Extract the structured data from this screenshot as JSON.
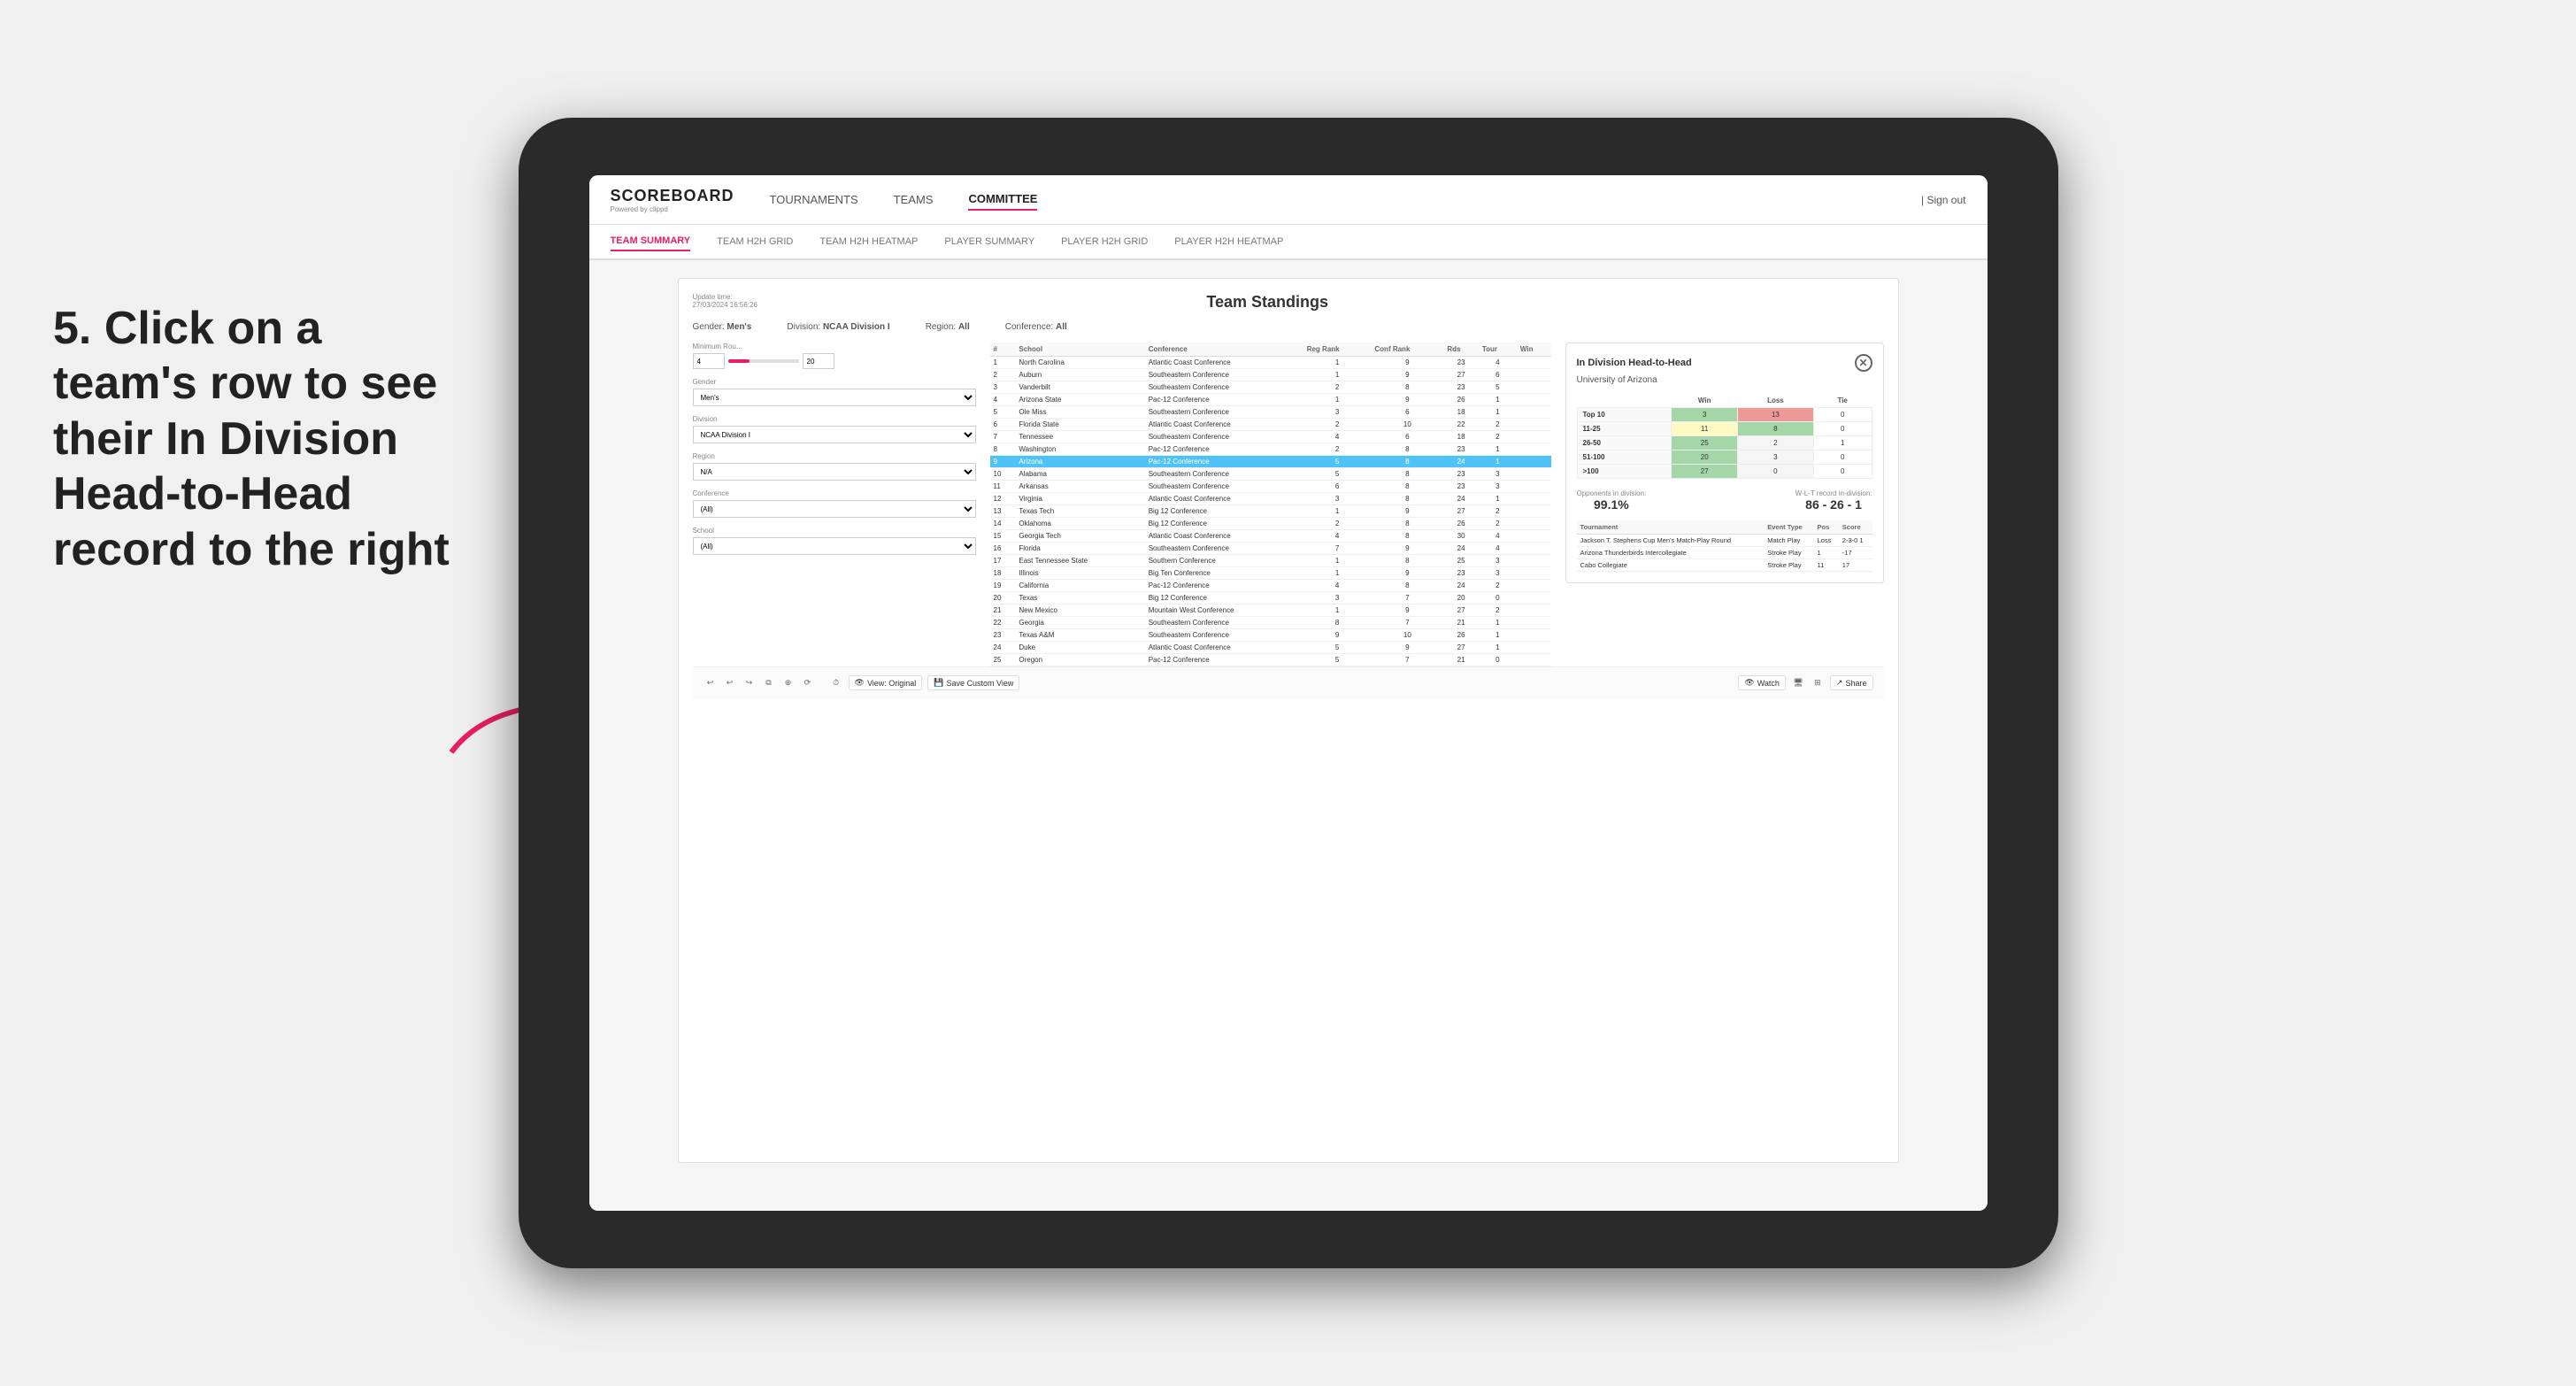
{
  "logo": {
    "name": "SCOREBOARD",
    "sub": "Powered by clippd"
  },
  "nav": {
    "items": [
      "TOURNAMENTS",
      "TEAMS",
      "COMMITTEE"
    ],
    "active": "COMMITTEE",
    "sign_out": "Sign out"
  },
  "sub_nav": {
    "items": [
      "TEAM SUMMARY",
      "TEAM H2H GRID",
      "TEAM H2H HEATMAP",
      "PLAYER SUMMARY",
      "PLAYER H2H GRID",
      "PLAYER H2H HEATMAP"
    ],
    "active": "TEAM SUMMARY"
  },
  "panel": {
    "update_time_label": "Update time:",
    "update_time_value": "27/03/2024 16:56:26",
    "title": "Team Standings",
    "filters": {
      "gender_label": "Gender:",
      "gender_value": "Men's",
      "division_label": "Division:",
      "division_value": "NCAA Division I",
      "region_label": "Region:",
      "region_value": "All",
      "conference_label": "Conference:",
      "conference_value": "All"
    }
  },
  "left_filters": {
    "min_rounds_label": "Minimum Rou...",
    "min_rounds_value": "4",
    "min_rounds_max": "20",
    "gender_label": "Gender",
    "gender_value": "Men's",
    "division_label": "Division",
    "division_value": "NCAA Division I",
    "region_label": "Region",
    "region_value": "N/A",
    "conference_label": "Conference",
    "conference_value": "(All)",
    "school_label": "School",
    "school_value": "(All)"
  },
  "table": {
    "headers": [
      "#",
      "School",
      "Conference",
      "Reg Rank",
      "Conf Rank",
      "Rds",
      "Tour",
      "Win"
    ],
    "rows": [
      {
        "num": 1,
        "school": "North Carolina",
        "conference": "Atlantic Coast Conference",
        "reg_rank": 1,
        "conf_rank": 9,
        "rds": 23,
        "tour": 4,
        "win": null,
        "highlighted": false
      },
      {
        "num": 2,
        "school": "Auburn",
        "conference": "Southeastern Conference",
        "reg_rank": 1,
        "conf_rank": 9,
        "rds": 27,
        "tour": 6,
        "win": null,
        "highlighted": false
      },
      {
        "num": 3,
        "school": "Vanderbilt",
        "conference": "Southeastern Conference",
        "reg_rank": 2,
        "conf_rank": 8,
        "rds": 23,
        "tour": 5,
        "win": null,
        "highlighted": false
      },
      {
        "num": 4,
        "school": "Arizona State",
        "conference": "Pac-12 Conference",
        "reg_rank": 1,
        "conf_rank": 9,
        "rds": 26,
        "tour": 1,
        "win": null,
        "highlighted": false
      },
      {
        "num": 5,
        "school": "Ole Miss",
        "conference": "Southeastern Conference",
        "reg_rank": 3,
        "conf_rank": 6,
        "rds": 18,
        "tour": 1,
        "win": null,
        "highlighted": false
      },
      {
        "num": 6,
        "school": "Florida State",
        "conference": "Atlantic Coast Conference",
        "reg_rank": 2,
        "conf_rank": 10,
        "rds": 22,
        "tour": 2,
        "win": null,
        "highlighted": false
      },
      {
        "num": 7,
        "school": "Tennessee",
        "conference": "Southeastern Conference",
        "reg_rank": 4,
        "conf_rank": 6,
        "rds": 18,
        "tour": 2,
        "win": null,
        "highlighted": false
      },
      {
        "num": 8,
        "school": "Washington",
        "conference": "Pac-12 Conference",
        "reg_rank": 2,
        "conf_rank": 8,
        "rds": 23,
        "tour": 1,
        "win": null,
        "highlighted": false
      },
      {
        "num": 9,
        "school": "Arizona",
        "conference": "Pac-12 Conference",
        "reg_rank": 5,
        "conf_rank": 8,
        "rds": 24,
        "tour": 1,
        "win": null,
        "highlighted": true
      },
      {
        "num": 10,
        "school": "Alabama",
        "conference": "Southeastern Conference",
        "reg_rank": 5,
        "conf_rank": 8,
        "rds": 23,
        "tour": 3,
        "win": null,
        "highlighted": false
      },
      {
        "num": 11,
        "school": "Arkansas",
        "conference": "Southeastern Conference",
        "reg_rank": 6,
        "conf_rank": 8,
        "rds": 23,
        "tour": 3,
        "win": null,
        "highlighted": false
      },
      {
        "num": 12,
        "school": "Virginia",
        "conference": "Atlantic Coast Conference",
        "reg_rank": 3,
        "conf_rank": 8,
        "rds": 24,
        "tour": 1,
        "win": null,
        "highlighted": false
      },
      {
        "num": 13,
        "school": "Texas Tech",
        "conference": "Big 12 Conference",
        "reg_rank": 1,
        "conf_rank": 9,
        "rds": 27,
        "tour": 2,
        "win": null,
        "highlighted": false
      },
      {
        "num": 14,
        "school": "Oklahoma",
        "conference": "Big 12 Conference",
        "reg_rank": 2,
        "conf_rank": 8,
        "rds": 26,
        "tour": 2,
        "win": null,
        "highlighted": false
      },
      {
        "num": 15,
        "school": "Georgia Tech",
        "conference": "Atlantic Coast Conference",
        "reg_rank": 4,
        "conf_rank": 8,
        "rds": 30,
        "tour": 4,
        "win": null,
        "highlighted": false
      },
      {
        "num": 16,
        "school": "Florida",
        "conference": "Southeastern Conference",
        "reg_rank": 7,
        "conf_rank": 9,
        "rds": 24,
        "tour": 4,
        "win": null,
        "highlighted": false
      },
      {
        "num": 17,
        "school": "East Tennessee State",
        "conference": "Southern Conference",
        "reg_rank": 1,
        "conf_rank": 8,
        "rds": 25,
        "tour": 3,
        "win": null,
        "highlighted": false
      },
      {
        "num": 18,
        "school": "Illinois",
        "conference": "Big Ten Conference",
        "reg_rank": 1,
        "conf_rank": 9,
        "rds": 23,
        "tour": 3,
        "win": null,
        "highlighted": false
      },
      {
        "num": 19,
        "school": "California",
        "conference": "Pac-12 Conference",
        "reg_rank": 4,
        "conf_rank": 8,
        "rds": 24,
        "tour": 2,
        "win": null,
        "highlighted": false
      },
      {
        "num": 20,
        "school": "Texas",
        "conference": "Big 12 Conference",
        "reg_rank": 3,
        "conf_rank": 7,
        "rds": 20,
        "tour": 0,
        "win": null,
        "highlighted": false
      },
      {
        "num": 21,
        "school": "New Mexico",
        "conference": "Mountain West Conference",
        "reg_rank": 1,
        "conf_rank": 9,
        "rds": 27,
        "tour": 2,
        "win": null,
        "highlighted": false
      },
      {
        "num": 22,
        "school": "Georgia",
        "conference": "Southeastern Conference",
        "reg_rank": 8,
        "conf_rank": 7,
        "rds": 21,
        "tour": 1,
        "win": null,
        "highlighted": false
      },
      {
        "num": 23,
        "school": "Texas A&M",
        "conference": "Southeastern Conference",
        "reg_rank": 9,
        "conf_rank": 10,
        "rds": 26,
        "tour": 1,
        "win": null,
        "highlighted": false
      },
      {
        "num": 24,
        "school": "Duke",
        "conference": "Atlantic Coast Conference",
        "reg_rank": 5,
        "conf_rank": 9,
        "rds": 27,
        "tour": 1,
        "win": null,
        "highlighted": false
      },
      {
        "num": 25,
        "school": "Oregon",
        "conference": "Pac-12 Conference",
        "reg_rank": 5,
        "conf_rank": 7,
        "rds": 21,
        "tour": 0,
        "win": null,
        "highlighted": false
      }
    ]
  },
  "h2h": {
    "title": "In Division Head-to-Head",
    "team": "University of Arizona",
    "col_headers": [
      "Win",
      "Loss",
      "Tie"
    ],
    "ranges": [
      {
        "label": "Top 10",
        "win": 3,
        "loss": 13,
        "tie": 0,
        "win_color": "green",
        "loss_color": "red"
      },
      {
        "label": "11-25",
        "win": 11,
        "loss": 8,
        "tie": 0,
        "win_color": "yellow",
        "loss_color": "green"
      },
      {
        "label": "26-50",
        "win": 25,
        "loss": 2,
        "tie": 1,
        "win_color": "green",
        "loss_color": "gray"
      },
      {
        "label": "51-100",
        "win": 20,
        "loss": 3,
        "tie": 0,
        "win_color": "green",
        "loss_color": "gray"
      },
      {
        "label": ">100",
        "win": 27,
        "loss": 0,
        "tie": 0,
        "win_color": "green",
        "loss_color": "gray"
      }
    ],
    "opponents_label": "Opponents in division:",
    "opponents_value": "99.1%",
    "record_label": "W-L-T record in-division:",
    "record_value": "86 - 26 - 1",
    "tournaments": [
      {
        "name": "Jackson T. Stephens Cup Men's Match-Play Round",
        "event_type": "Match Play",
        "pos": "Loss",
        "score": "2-3-0 1"
      },
      {
        "name": "Arizona Thunderbirds Intercollegiate",
        "event_type": "Stroke Play",
        "pos": "1",
        "score": "-17"
      },
      {
        "name": "Cabo Collegiate",
        "event_type": "Stroke Play",
        "pos": "11",
        "score": "17"
      }
    ],
    "tournament_headers": [
      "Tournament",
      "Event Type",
      "Pos",
      "Score"
    ]
  },
  "annotation": {
    "text": "5. Click on a team's row to see their In Division Head-to-Head record to the right"
  },
  "toolbar": {
    "undo_label": "↩",
    "redo_label": "↪",
    "view_original_label": "View: Original",
    "save_custom_label": "Save Custom View",
    "watch_label": "Watch",
    "share_label": "Share"
  }
}
